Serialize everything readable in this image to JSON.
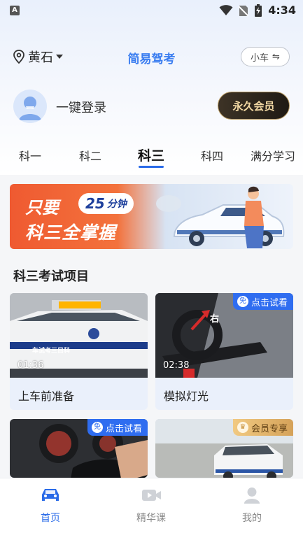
{
  "status_bar": {
    "time": "4:34",
    "app_icon_letter": "A"
  },
  "header": {
    "city": "黄石",
    "title": "简易驾考",
    "car_type": "小车",
    "car_switch_symbol": "⇋"
  },
  "login": {
    "text": "一键登录",
    "vip_button": "永久会员"
  },
  "tabs": [
    {
      "label": "科一",
      "active": false
    },
    {
      "label": "科二",
      "active": false
    },
    {
      "label": "科三",
      "active": true
    },
    {
      "label": "科四",
      "active": false
    },
    {
      "label": "满分学习",
      "active": false
    }
  ],
  "banner": {
    "prefix": "只要",
    "number": "25",
    "unit": "分钟",
    "line2": "科三全掌握"
  },
  "section_title": "科三考试项目",
  "cards": [
    {
      "label": "上车前准备",
      "duration": "01:36",
      "badge": ""
    },
    {
      "label": "模拟灯光",
      "duration": "02:38",
      "badge": "点击试看",
      "badge_icon": "免",
      "photo_text": "右"
    },
    {
      "label": "",
      "duration": "",
      "badge": "点击试看",
      "badge_icon": "免"
    },
    {
      "label": "",
      "duration": "",
      "badge": "会员专享",
      "badge_icon": "♛"
    }
  ],
  "car1_door_text": "车试考三目科",
  "bottom_nav": [
    {
      "label": "首页",
      "icon": "car-icon",
      "active": true
    },
    {
      "label": "精华课",
      "icon": "video-icon",
      "active": false
    },
    {
      "label": "我的",
      "icon": "user-icon",
      "active": false
    }
  ],
  "colors": {
    "accent": "#2a6be8",
    "banner_orange": "#ef5a31",
    "vip_gold": "#f3d9a4"
  }
}
